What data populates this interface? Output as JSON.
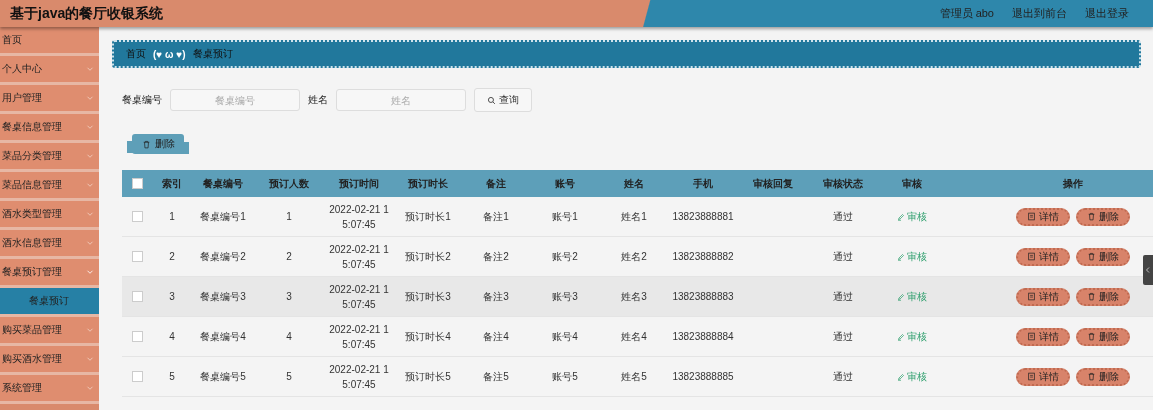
{
  "header": {
    "title": "基于java的餐厅收银系统",
    "user": "管理员 abo",
    "links": [
      "退出到前台",
      "退出登录"
    ]
  },
  "sidebar": {
    "items": [
      {
        "label": "首页",
        "kind": "link",
        "selected": false
      },
      {
        "label": "个人中心",
        "kind": "group",
        "expanded": false,
        "selected": false
      },
      {
        "label": "用户管理",
        "kind": "group",
        "expanded": false,
        "selected": false
      },
      {
        "label": "餐桌信息管理",
        "kind": "group",
        "expanded": false,
        "selected": false
      },
      {
        "label": "菜品分类管理",
        "kind": "group",
        "expanded": false,
        "selected": false
      },
      {
        "label": "菜品信息管理",
        "kind": "group",
        "expanded": false,
        "selected": false
      },
      {
        "label": "酒水类型管理",
        "kind": "group",
        "expanded": false,
        "selected": false
      },
      {
        "label": "酒水信息管理",
        "kind": "group",
        "expanded": false,
        "selected": false
      },
      {
        "label": "餐桌预订管理",
        "kind": "group",
        "expanded": true,
        "selected": false,
        "children": [
          {
            "label": "餐桌预订",
            "selected": true
          }
        ]
      },
      {
        "label": "购买菜品管理",
        "kind": "group",
        "expanded": false,
        "selected": false
      },
      {
        "label": "购买酒水管理",
        "kind": "group",
        "expanded": false,
        "selected": false
      },
      {
        "label": "系统管理",
        "kind": "group",
        "expanded": false,
        "selected": false
      }
    ]
  },
  "breadcrumb": {
    "home": "首页",
    "separator": "(♥ ω ♥)",
    "current": "餐桌预订"
  },
  "search": {
    "fields": [
      {
        "label": "餐桌编号",
        "placeholder": "餐桌编号"
      },
      {
        "label": "姓名",
        "placeholder": "姓名"
      }
    ],
    "button": "查询"
  },
  "batch_delete": "删除",
  "table": {
    "header_checked": false,
    "columns": [
      "索引",
      "餐桌编号",
      "预订人数",
      "预订时间",
      "预订时长",
      "备注",
      "账号",
      "姓名",
      "手机",
      "审核回复",
      "审核状态",
      "审核",
      "操作"
    ],
    "rows": [
      {
        "checked": false,
        "highlighted": false,
        "index": "1",
        "table_no": "餐桌编号1",
        "people": "1",
        "time": "2022-02-21 15:07:45",
        "duration": "预订时长1",
        "note": "备注1",
        "account": "账号1",
        "name": "姓名1",
        "phone": "13823888881",
        "status": "通过",
        "review": "审核",
        "actions": [
          "详情",
          "删除"
        ]
      },
      {
        "checked": false,
        "highlighted": false,
        "index": "2",
        "table_no": "餐桌编号2",
        "people": "2",
        "time": "2022-02-21 15:07:45",
        "duration": "预订时长2",
        "note": "备注2",
        "account": "账号2",
        "name": "姓名2",
        "phone": "13823888882",
        "status": "通过",
        "review": "审核",
        "actions": [
          "详情",
          "删除"
        ]
      },
      {
        "checked": false,
        "highlighted": true,
        "index": "3",
        "table_no": "餐桌编号3",
        "people": "3",
        "time": "2022-02-21 15:07:45",
        "duration": "预订时长3",
        "note": "备注3",
        "account": "账号3",
        "name": "姓名3",
        "phone": "13823888883",
        "status": "通过",
        "review": "审核",
        "actions": [
          "详情",
          "删除"
        ]
      },
      {
        "checked": false,
        "highlighted": false,
        "index": "4",
        "table_no": "餐桌编号4",
        "people": "4",
        "time": "2022-02-21 15:07:45",
        "duration": "预订时长4",
        "note": "备注4",
        "account": "账号4",
        "name": "姓名4",
        "phone": "13823888884",
        "status": "通过",
        "review": "审核",
        "actions": [
          "详情",
          "删除"
        ]
      },
      {
        "checked": false,
        "highlighted": false,
        "index": "5",
        "table_no": "餐桌编号5",
        "people": "5",
        "time": "2022-02-21 15:07:45",
        "duration": "预订时长5",
        "note": "备注5",
        "account": "账号5",
        "name": "姓名5",
        "phone": "13823888885",
        "status": "通过",
        "review": "审核",
        "actions": [
          "详情",
          "删除"
        ]
      }
    ]
  }
}
